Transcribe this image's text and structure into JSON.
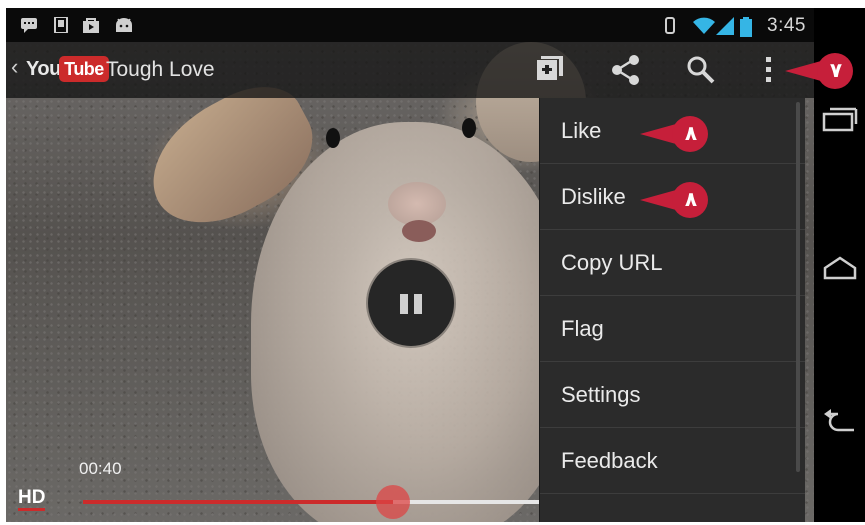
{
  "status_bar": {
    "icons": [
      "chat-icon",
      "sd-card-icon",
      "store-bag-icon",
      "android-icon"
    ],
    "right_icons": [
      "vibrate-icon",
      "wifi-icon",
      "signal-icon",
      "battery-icon"
    ],
    "time": "3:45"
  },
  "action_bar": {
    "back_glyph": "‹",
    "logo_you": "You",
    "logo_tube": "Tube",
    "title": "Tough Love",
    "buttons": [
      "add-to-playlist-icon",
      "share-icon",
      "search-icon",
      "overflow-menu-icon"
    ]
  },
  "menu": {
    "items": [
      {
        "label": "Like"
      },
      {
        "label": "Dislike"
      },
      {
        "label": "Copy URL"
      },
      {
        "label": "Flag"
      },
      {
        "label": "Settings"
      },
      {
        "label": "Feedback"
      }
    ]
  },
  "annotations": {
    "overflow_marker": "٧",
    "like_marker": "٨",
    "dislike_marker": "٨"
  },
  "player": {
    "elapsed": "00:40",
    "quality": "HD",
    "progress_fraction": 0.68
  },
  "nav_bar": {
    "buttons": [
      "recent-apps-icon",
      "home-icon",
      "back-icon"
    ]
  },
  "colors": {
    "accent_red": "#cc2b2b",
    "annotation_red": "#c61f3a",
    "menu_bg": "#2b2b2b"
  }
}
